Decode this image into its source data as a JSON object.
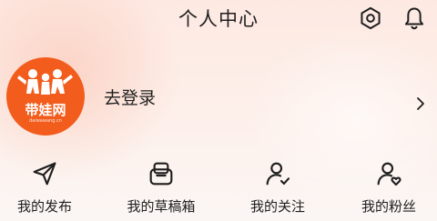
{
  "header": {
    "title": "个人中心",
    "icons": [
      "gear-icon",
      "bell-icon"
    ]
  },
  "profile": {
    "avatar_logo_text": "带娃网",
    "avatar_logo_subtext": "daiwawang.cn",
    "login_label": "去登录",
    "chevron_icon": "chevron-right-icon",
    "avatar_color": "#f25c1c"
  },
  "menu": {
    "items": [
      {
        "label": "我的发布",
        "icon": "send-icon"
      },
      {
        "label": "我的草稿箱",
        "icon": "drafts-box-icon"
      },
      {
        "label": "我的关注",
        "icon": "user-check-icon"
      },
      {
        "label": "我的粉丝",
        "icon": "user-heart-icon"
      }
    ]
  }
}
